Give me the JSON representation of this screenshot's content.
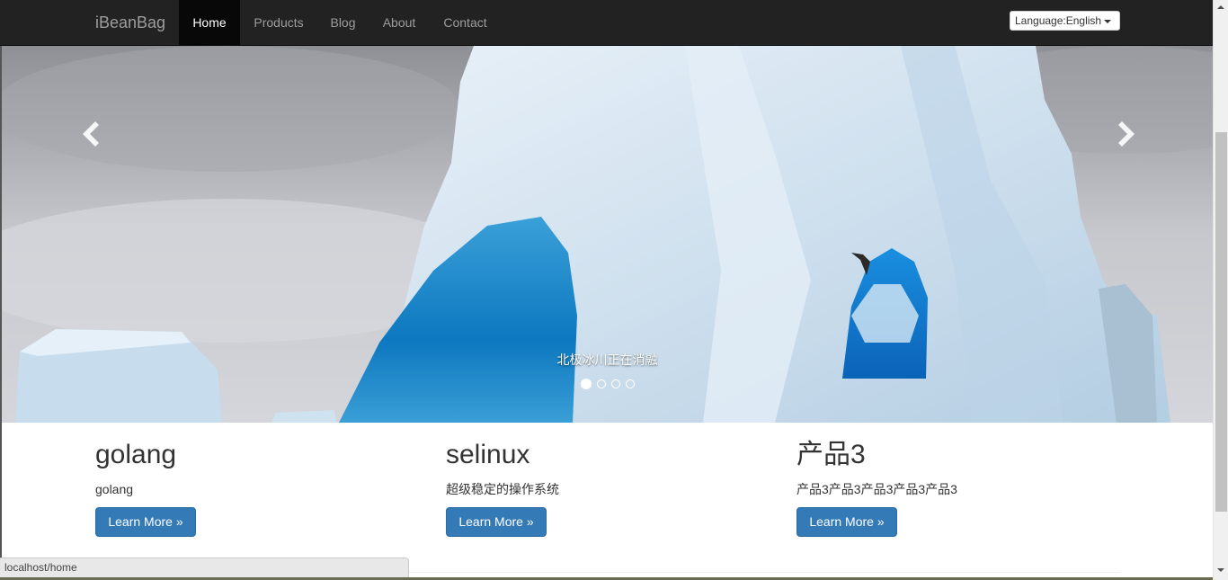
{
  "navbar": {
    "brand": "iBeanBag",
    "items": [
      {
        "label": "Home",
        "active": true
      },
      {
        "label": "Products",
        "active": false
      },
      {
        "label": "Blog",
        "active": false
      },
      {
        "label": "About",
        "active": false
      },
      {
        "label": "Contact",
        "active": false
      }
    ],
    "language_button": "Language:English"
  },
  "carousel": {
    "caption": "北极冰川正在消融",
    "prev_icon": "chevron-left-icon",
    "next_icon": "chevron-right-icon",
    "slide_count": 4,
    "active_index": 0
  },
  "features": [
    {
      "title": "golang",
      "text": "golang",
      "button": "Learn More »"
    },
    {
      "title": "selinux",
      "text": "超级稳定的操作系统",
      "button": "Learn More »"
    },
    {
      "title": "产品3",
      "text": "产品3产品3产品3产品3产品3",
      "button": "Learn More »"
    }
  ],
  "status_bar": {
    "url": "localhost/home"
  },
  "colors": {
    "navbar_bg": "#222222",
    "nav_active_bg": "#080808",
    "button_primary": "#337ab7"
  }
}
